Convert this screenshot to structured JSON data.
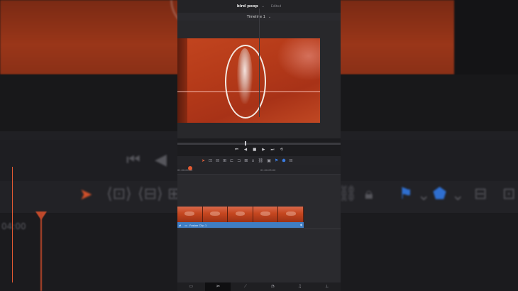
{
  "header": {
    "project_name": "bird poop",
    "project_caret": "⌄",
    "status": "Edited",
    "timeline_name": "Timeline 1",
    "timeline_caret": "⌄"
  },
  "transport": {
    "icons": [
      "skip-to-start-icon",
      "step-back-icon",
      "stop-icon",
      "play-icon",
      "skip-to-end-icon",
      "loop-icon"
    ]
  },
  "toolbar": {
    "icons": [
      "select-arrow-icon",
      "trim-icon",
      "blade-icon",
      "razor-icon",
      "overwrite-icon",
      "insert-icon",
      "magnet-icon",
      "link-icon",
      "lock-icon",
      "flag-icon",
      "marker-icon",
      "zoom-icon"
    ]
  },
  "timeline": {
    "start_tc": "01:00:00:00",
    "mid_tc": "01:00:05:00",
    "clip_name": "Fusion Clip 1",
    "thumbnail_count": 5
  },
  "background": {
    "timecode": "04:00"
  },
  "bottom_nav": {
    "items": [
      "media-icon",
      "cut-icon",
      "edit-icon",
      "color-icon",
      "audio-icon",
      "deliver-icon"
    ],
    "active_index": 1
  },
  "colors": {
    "accent_playhead": "#e35a32",
    "clip_blue": "#3f7ec4",
    "panel_bg": "#1c1c1f"
  }
}
